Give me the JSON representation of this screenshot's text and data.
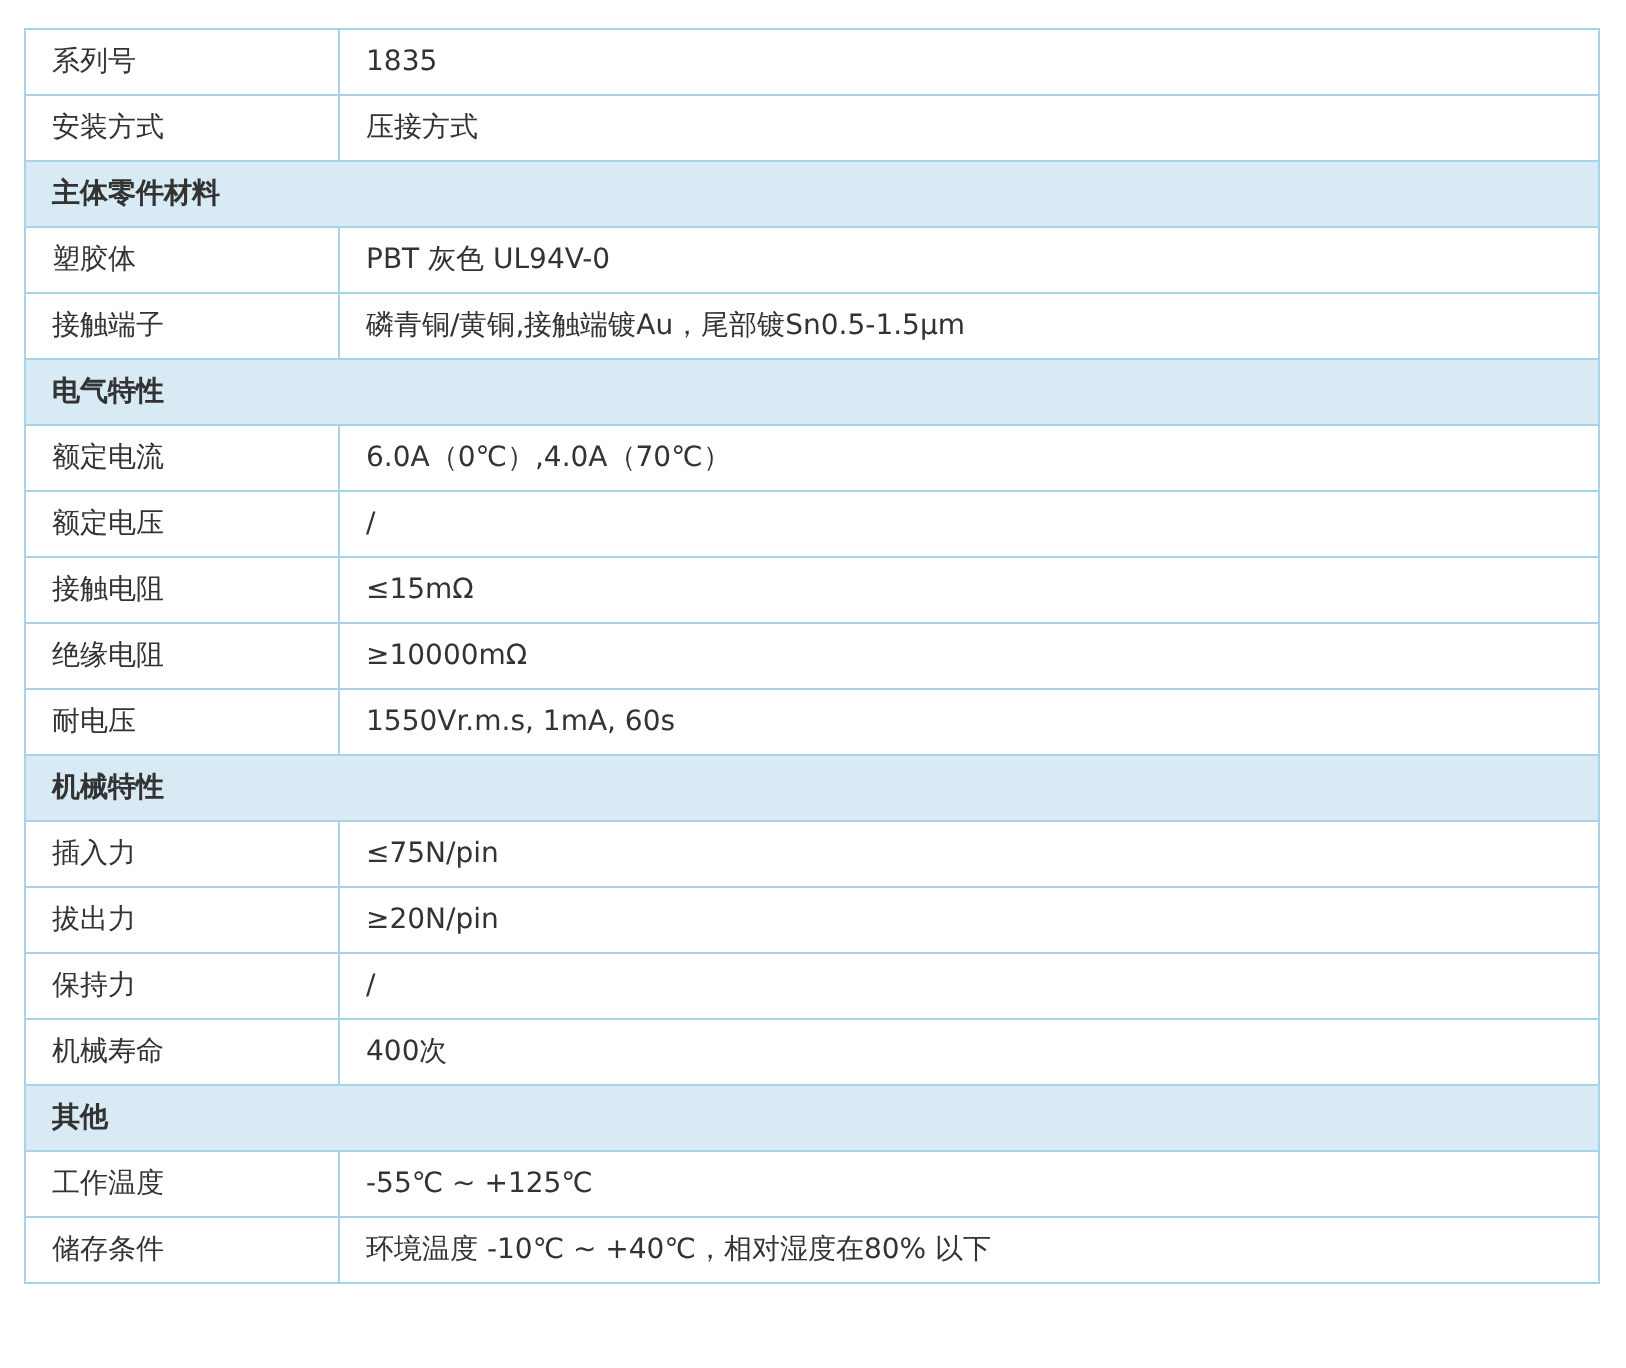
{
  "rows": [
    {
      "kind": "row",
      "label": "系列号",
      "value": "1835"
    },
    {
      "kind": "row",
      "label": "安装方式",
      "value": "压接方式"
    },
    {
      "kind": "section",
      "label": "主体零件材料"
    },
    {
      "kind": "row",
      "label": "塑胶体",
      "value": "PBT 灰色 UL94V-0"
    },
    {
      "kind": "row",
      "label": "接触端子",
      "value": "磷青铜/黄铜,接触端镀Au，尾部镀Sn0.5-1.5μm"
    },
    {
      "kind": "section",
      "label": "电气特性"
    },
    {
      "kind": "row",
      "label": "额定电流",
      "value": "6.0A（0℃）,4.0A（70℃）"
    },
    {
      "kind": "row",
      "label": "额定电压",
      "value": "/"
    },
    {
      "kind": "row",
      "label": "接触电阻",
      "value": "≤15mΩ"
    },
    {
      "kind": "row",
      "label": "绝缘电阻",
      "value": "≥10000mΩ"
    },
    {
      "kind": "row",
      "label": "耐电压",
      "value": "1550Vr.m.s, 1mA, 60s"
    },
    {
      "kind": "section",
      "label": "机械特性"
    },
    {
      "kind": "row",
      "label": "插入力",
      "value": "≤75N/pin"
    },
    {
      "kind": "row",
      "label": "拔出力",
      "value": "≥20N/pin"
    },
    {
      "kind": "row",
      "label": "保持力",
      "value": "/"
    },
    {
      "kind": "row",
      "label": "机械寿命",
      "value": "400次"
    },
    {
      "kind": "section",
      "label": "其他"
    },
    {
      "kind": "row",
      "label": "工作温度",
      "value": "-55℃ ~ +125℃"
    },
    {
      "kind": "row",
      "label": "储存条件",
      "value": "环境温度 -10℃ ~ +40℃，相对湿度在80% 以下"
    }
  ]
}
